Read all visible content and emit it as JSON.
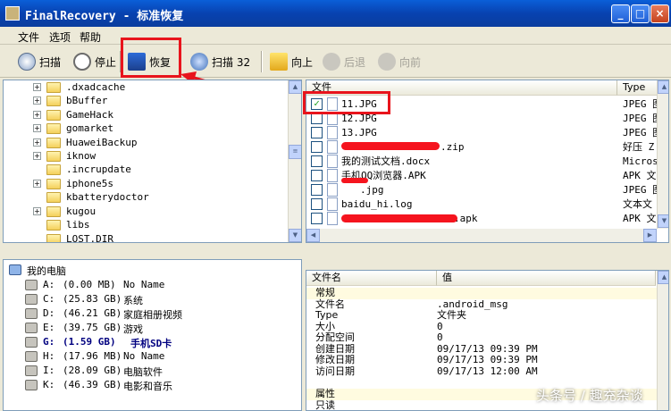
{
  "window": {
    "title": "FinalRecovery - 标准恢复",
    "buttons": [
      "_",
      "□",
      "×"
    ]
  },
  "menu": {
    "items": [
      "文件",
      "选项",
      "帮助"
    ]
  },
  "toolbar": {
    "scan": "扫描",
    "stop": "停止",
    "recover": "恢复",
    "scan32": "扫描 32",
    "up": "向上",
    "back": "后退",
    "forward": "向前"
  },
  "folders": [
    ".dxadcache",
    "bBuffer",
    "GameHack",
    "gomarket",
    "HuaweiBackup",
    "iknow",
    ".incrupdate",
    "iphone5s",
    "kbatterydoctor",
    "kugou",
    "libs",
    "LOST.DIR"
  ],
  "files": {
    "headers": {
      "name": "文件",
      "type": "Type"
    },
    "rows": [
      {
        "name": "11.JPG",
        "type": "JPEG 图",
        "checked": true
      },
      {
        "name": "12.JPG",
        "type": "JPEG 图",
        "checked": false
      },
      {
        "name": "13.JPG",
        "type": "JPEG 图",
        "checked": false
      },
      {
        "name": ".zip",
        "type": "好压 Z",
        "checked": false
      },
      {
        "name": "我的测试文档.docx",
        "type": "Micros",
        "checked": false
      },
      {
        "name": "手机QQ浏览器.APK",
        "type": "APK 文",
        "checked": false
      },
      {
        "name": ".jpg",
        "type": "JPEG 图",
        "checked": false
      },
      {
        "name": "baidu_hi.log",
        "type": "文本文",
        "checked": false
      },
      {
        "name": ".apk",
        "type": "APK 文",
        "checked": false
      }
    ]
  },
  "drives": {
    "root": "我的电脑",
    "list": [
      {
        "letter": "A:",
        "size": "(0.00 MB)",
        "label": "No Name",
        "selected": false
      },
      {
        "letter": "C:",
        "size": "(25.83 GB)",
        "label": "系统",
        "selected": false
      },
      {
        "letter": "D:",
        "size": "(46.21 GB)",
        "label": "家庭相册视频",
        "selected": false
      },
      {
        "letter": "E:",
        "size": "(39.75 GB)",
        "label": "游戏",
        "selected": false
      },
      {
        "letter": "G:",
        "size": "(1.59 GB)",
        "label": "手机SD卡",
        "selected": true
      },
      {
        "letter": "H:",
        "size": "(17.96 MB)",
        "label": "No Name",
        "selected": false
      },
      {
        "letter": "I:",
        "size": "(28.09 GB)",
        "label": "电脑软件",
        "selected": false
      },
      {
        "letter": "K:",
        "size": "(46.39 GB)",
        "label": "电影和音乐",
        "selected": false
      }
    ]
  },
  "properties": {
    "headers": {
      "name": "文件名",
      "value": "值"
    },
    "rows": [
      {
        "k": "常规",
        "v": "",
        "group": true
      },
      {
        "k": "文件名",
        "v": ".android_msg",
        "group": false
      },
      {
        "k": "Type",
        "v": "文件夹",
        "group": false
      },
      {
        "k": "大小",
        "v": "0",
        "group": false
      },
      {
        "k": "分配空间",
        "v": "0",
        "group": false
      },
      {
        "k": "创建日期",
        "v": "09/17/13 09:39 PM",
        "group": false
      },
      {
        "k": "修改日期",
        "v": "09/17/13 09:39 PM",
        "group": false
      },
      {
        "k": "访问日期",
        "v": "09/17/13 12:00 AM",
        "group": false
      },
      {
        "k": "",
        "v": "",
        "group": false
      },
      {
        "k": "属性",
        "v": "",
        "group": true
      },
      {
        "k": "只读",
        "v": "",
        "group": false
      }
    ]
  },
  "watermark": "头条号 / 趣充杂谈",
  "colors": {
    "title_blue": "#0a5fd8",
    "highlight_red": "#e8141c",
    "selected_drive": "#000080"
  }
}
